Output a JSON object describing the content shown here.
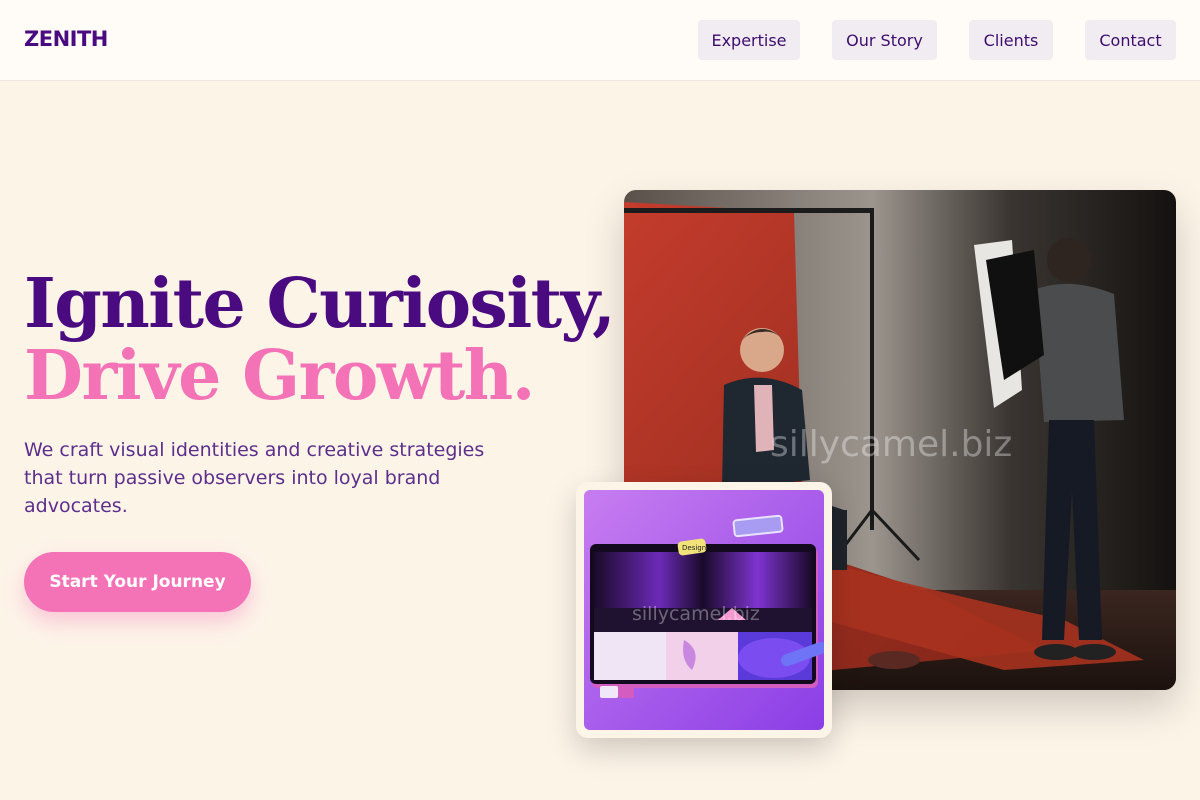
{
  "brand": {
    "logo": "ZENITH"
  },
  "nav": {
    "items": [
      {
        "label": "Expertise"
      },
      {
        "label": "Our Story"
      },
      {
        "label": "Clients"
      },
      {
        "label": "Contact"
      }
    ]
  },
  "hero": {
    "title_line1": "Ignite Curiosity,",
    "title_line2": "Drive Growth.",
    "subtitle": "We craft visual identities and creative strategies that turn passive observers into loyal brand advocates.",
    "cta_label": "Start Your Journey"
  },
  "images": {
    "main": {
      "watermark": "sillycamel.biz"
    },
    "secondary": {
      "watermark": "sillycamel.biz",
      "sticker_label": "Design"
    }
  },
  "colors": {
    "background": "#fdf4e8",
    "brand_purple": "#4a0a80",
    "accent_pink": "#f472b6",
    "nav_button_bg": "#f1ecf1"
  }
}
